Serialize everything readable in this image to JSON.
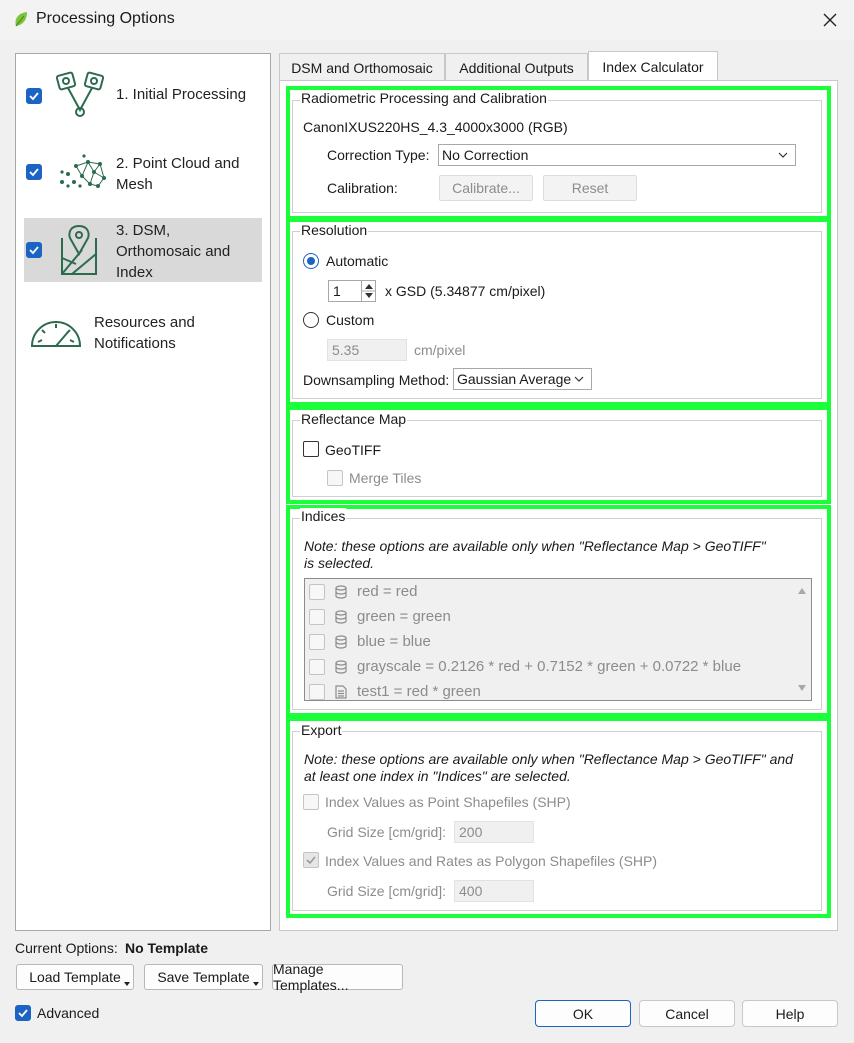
{
  "window": {
    "title": "Processing Options",
    "icon": "leaf-icon",
    "accent_color": "#1c64c4",
    "highlight_color": "#1aff3a"
  },
  "nav": {
    "items": [
      {
        "label": "1. Initial Processing",
        "checked": true,
        "icon": "initial-processing-icon",
        "selected": false
      },
      {
        "label": "2. Point Cloud and\nMesh",
        "checked": true,
        "icon": "point-cloud-icon",
        "selected": false
      },
      {
        "label": "3. DSM,\nOrthomosaic and\nIndex",
        "checked": true,
        "icon": "map-pin-icon",
        "selected": true
      },
      {
        "label": "Resources and\nNotifications",
        "checked": null,
        "icon": "gauge-icon",
        "selected": false
      }
    ]
  },
  "tabs": [
    {
      "label": "DSM and Orthomosaic",
      "active": false
    },
    {
      "label": "Additional Outputs",
      "active": false
    },
    {
      "label": "Index Calculator",
      "active": true
    }
  ],
  "radiometric": {
    "title": "Radiometric Processing and Calibration",
    "camera": "CanonIXUS220HS_4.3_4000x3000 (RGB)",
    "correction_label": "Correction Type:",
    "correction_value": "No Correction",
    "calibration_label": "Calibration:",
    "calibrate_button": "Calibrate...",
    "reset_button": "Reset"
  },
  "resolution": {
    "title": "Resolution",
    "automatic_label": "Automatic",
    "automatic_selected": true,
    "gsd_multiplier": "1",
    "gsd_text": "x GSD (5.34877 cm/pixel)",
    "custom_label": "Custom",
    "custom_value": "5.35",
    "custom_unit": "cm/pixel",
    "downsampling_label": "Downsampling Method:",
    "downsampling_value": "Gaussian Average"
  },
  "reflectance": {
    "title": "Reflectance Map",
    "geotiff_label": "GeoTIFF",
    "merge_tiles_label": "Merge Tiles"
  },
  "indices": {
    "title": "Indices",
    "note": "Note: these options are available only when \"Reflectance Map > GeoTIFF\" is selected.",
    "items": [
      {
        "label": "red = red",
        "icon": "database-icon"
      },
      {
        "label": "green = green",
        "icon": "database-icon"
      },
      {
        "label": "blue = blue",
        "icon": "database-icon"
      },
      {
        "label": "grayscale = 0.2126 * red + 0.7152 * green + 0.0722 * blue",
        "icon": "database-icon"
      },
      {
        "label": "test1 = red * green",
        "icon": "document-icon"
      }
    ]
  },
  "export": {
    "title": "Export",
    "note": "Note: these options are available only when \"Reflectance Map > GeoTIFF\" and at least one index in \"Indices\" are selected.",
    "point_shp_label": "Index Values as Point Shapefiles (SHP)",
    "point_shp_checked": false,
    "grid_size_label": "Grid Size [cm/grid]:",
    "point_grid_value": "200",
    "polygon_shp_label": "Index Values and Rates as Polygon Shapefiles (SHP)",
    "polygon_shp_checked": true,
    "polygon_grid_value": "400"
  },
  "footer": {
    "current_options_label": "Current Options:",
    "current_options_value": "No Template",
    "load_template": "Load Template",
    "save_template": "Save Template",
    "manage_templates": "Manage Templates...",
    "advanced_label": "Advanced",
    "advanced_checked": true,
    "ok": "OK",
    "cancel": "Cancel",
    "help": "Help"
  }
}
